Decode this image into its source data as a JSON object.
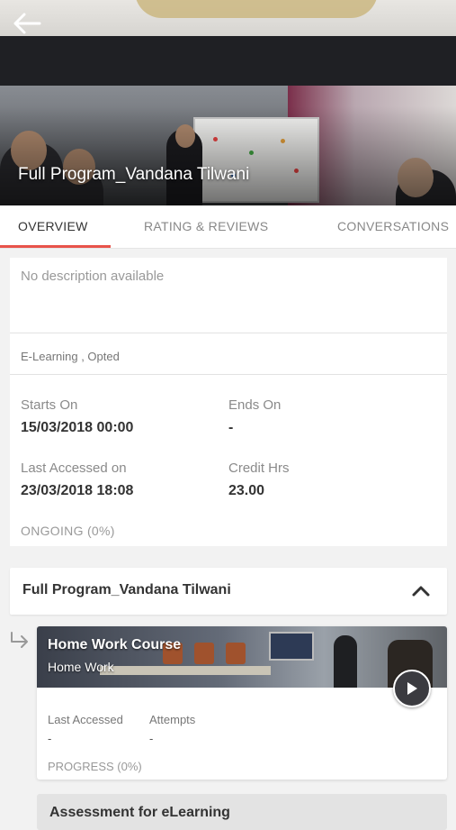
{
  "header": {
    "title": "Full Program_Vandana Tilwani",
    "back_icon": "arrow-left-icon"
  },
  "tabs": [
    {
      "label": "OVERVIEW",
      "active": true
    },
    {
      "label": "RATING & REVIEWS",
      "active": false
    },
    {
      "label": "CONVERSATIONS",
      "active": false
    }
  ],
  "overview": {
    "description": "No description available",
    "tags": "E-Learning , Opted",
    "starts_on_label": "Starts On",
    "starts_on_value": "15/03/2018 00:00",
    "ends_on_label": "Ends On",
    "ends_on_value": "-",
    "last_accessed_label": "Last Accessed on",
    "last_accessed_value": "23/03/2018 18:08",
    "credit_label": "Credit Hrs",
    "credit_value": "23.00",
    "status": "ONGOING (0%)"
  },
  "program_section": {
    "title": "Full Program_Vandana Tilwani",
    "expanded": true
  },
  "course": {
    "title": "Home Work Course",
    "subtitle": "Home Work",
    "last_accessed_label": "Last Accessed",
    "last_accessed_value": "-",
    "attempts_label": "Attempts",
    "attempts_value": "-",
    "progress": "PROGRESS (0%)"
  },
  "next_item": {
    "title": "Assessment for eLearning"
  },
  "colors": {
    "accent": "#e8534b",
    "background": "#f2f2f2"
  }
}
